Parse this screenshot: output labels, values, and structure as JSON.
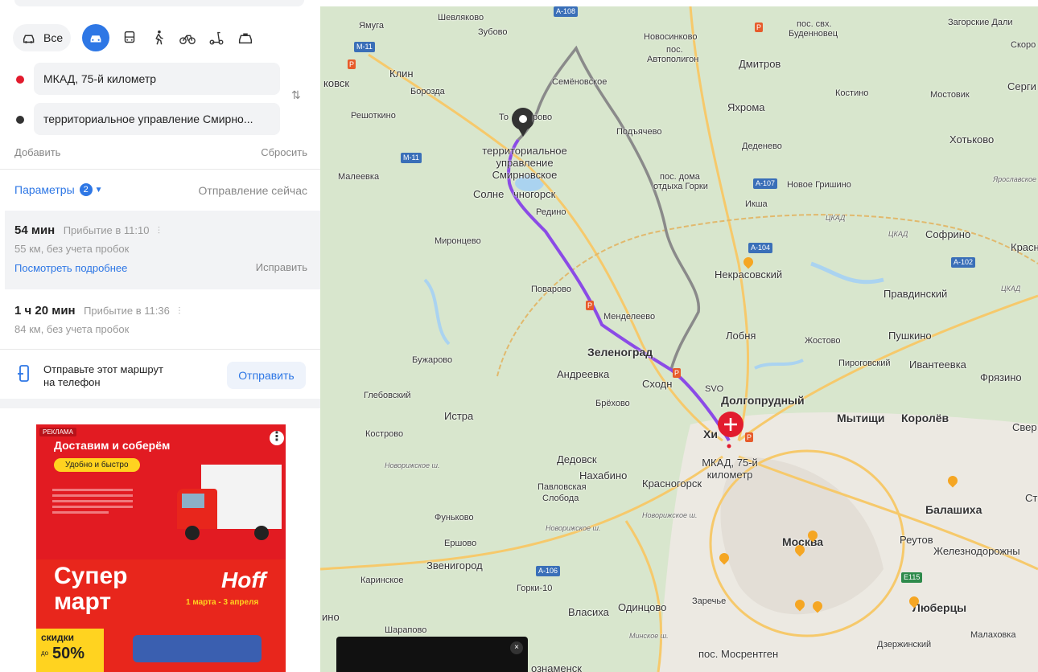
{
  "modes": {
    "all_label": "Все",
    "items": [
      {
        "name": "car-icon",
        "active": true
      },
      {
        "name": "bus-icon",
        "active": false
      },
      {
        "name": "walk-icon",
        "active": false
      },
      {
        "name": "bicycle-icon",
        "active": false
      },
      {
        "name": "scooter-icon",
        "active": false
      },
      {
        "name": "taxi-icon",
        "active": false
      }
    ]
  },
  "route_inputs": {
    "from_value": "МКАД, 75-й километр",
    "to_value": "территориальное управление Смирно...",
    "from_color": "#e21b2d",
    "to_color": "#333333"
  },
  "actions": {
    "add_label": "Добавить",
    "reset_label": "Сбросить"
  },
  "params": {
    "label": "Параметры",
    "count": "2",
    "departure": "Отправление сейчас"
  },
  "routes": [
    {
      "duration": "54 мин",
      "arrival": "Прибытие в 11:10",
      "distance": "55 км, без учета пробок",
      "details_link": "Посмотреть подробнее",
      "fix_link": "Исправить"
    },
    {
      "duration": "1 ч 20 мин",
      "arrival": "Прибытие в 11:36",
      "distance": "84 км, без учета пробок"
    }
  ],
  "send": {
    "text_line1": "Отправьте этот маршрут",
    "text_line2": "на телефон",
    "button": "Отправить"
  },
  "ad": {
    "badge": "РЕКЛАМА",
    "headline": "Доставим и соберём",
    "pill": "Удобно и быстро",
    "super1": "Супер",
    "super2": "март",
    "brand": "Hoff",
    "dates": "1 марта - 3 апреля",
    "discount_label": "скидки",
    "discount_to": "до",
    "discount_value": "50%"
  },
  "map": {
    "route_start_label": "МКАД, 75-й километр",
    "route_end_label": "территориальное управление Смирновское",
    "places": {
      "yamuga": "Ямуга",
      "shevlyakovo": "Шевляково",
      "zubovo": "Зубово",
      "a108": "А-108",
      "novosinkovo": "Новосинково",
      "pos_avtopoligon": "пос.",
      "avtopoligon": "Автополигон",
      "dmitrov": "Дмитров",
      "pos_svh": "пос. свх.",
      "budennovets": "Буденновец",
      "zagorskie": "Загорские Дали",
      "skoro": "Скоро",
      "m11a": "М-11",
      "klin": "Клин",
      "moskovsk": "ковск",
      "boroz": "Борозда",
      "semenovskoe": "Семёновское",
      "kostino": "Костино",
      "sergi": "Серги",
      "mostovik": "Мостовик",
      "reshotkino": "Решоткино",
      "toporovo1": "То",
      "toporovo2": "рово",
      "yakhroma": "Яхрома",
      "podyachevo": "Подъячево",
      "hotkovo": "Хотьково",
      "deденево": "Деденево",
      "m11b": "М-11",
      "maleevka": "Малеевка",
      "pos_doma": "пос. дома",
      "otdykha": "отдыха Горки",
      "a107": "А-107",
      "novoe_grishino": "Новое Гришино",
      "yaroslavskoe": "Ярославское",
      "solnechnogorsk1": "Солне",
      "solnechnogorsk2": "чногорск",
      "redino": "Редино",
      "iksha": "Икша",
      "tskad1": "ЦКАД",
      "tskad2": "ЦКАД",
      "sofrino": "Софрино",
      "mironcevo": "Миронцево",
      "a104": "А-104",
      "nekrasovsky": "Некрасовский",
      "a102": "А-102",
      "krasno": "Красн",
      "povarovo": "Поварово",
      "pravdinsky": "Правдинский",
      "tskad3": "ЦКАД",
      "mendeleevo": "Менделеево",
      "lobnya": "Лобня",
      "zhostovo": "Жостово",
      "pushkino": "Пушкино",
      "ivanteevka": "Ивантеевка",
      "pirogovsky": "Пироговский",
      "buzharovo": "Бужарово",
      "zelenograd": "Зеленоград",
      "andreevka": "Андреевка",
      "skhodnya": "Сходн",
      "svo": "SVO",
      "fryazino": "Фрязино",
      "dolgoprudny": "Долгопрудный",
      "glebovsky": "Глебовский",
      "brekhovo": "Брёхово",
      "istra": "Истра",
      "mytishchi": "Мытищи",
      "korolev": "Королёв",
      "sver": "Свер",
      "kostrovo": "Кострово",
      "khimki": "Хи",
      "dedovsk": "Дедовск",
      "nakhabino": "Нахабино",
      "krasnogorsk": "Красногорск",
      "pavlovskaya1": "Павловская",
      "pavlovskaya2": "Слобода",
      "balashikha": "Балашиха",
      "st": "Ст",
      "novorizhskoe": "Новорижское ш.",
      "novorizh2": "Новорижское ш.",
      "novorizh3": "Новорижское ш.",
      "funkovo": "Фуньково",
      "moskva": "Москва",
      "reutov": "Реутов",
      "zheleznodorozhny": "Железнодорожны",
      "erisovo": "Ершово",
      "zvenigorod": "Звенигород",
      "a106": "А-106",
      "karinskoe": "Каринское",
      "gorki10": "Горки-10",
      "e115": "Е115",
      "vlasikha": "Власиха",
      "odintsovo": "Одинцово",
      "zarechye": "Заречье",
      "lyubertsy": "Люберцы",
      "sharapovo": "Шарапово",
      "minskoe": "Минское ш.",
      "mosrentgen": "пос. Мосрентген",
      "dzerzhinsky": "Дзержинский",
      "malakhovka": "Малаховка",
      "izhno": "ино",
      "oznamensk": "ознаменск"
    }
  },
  "video": {
    "close": "×"
  }
}
